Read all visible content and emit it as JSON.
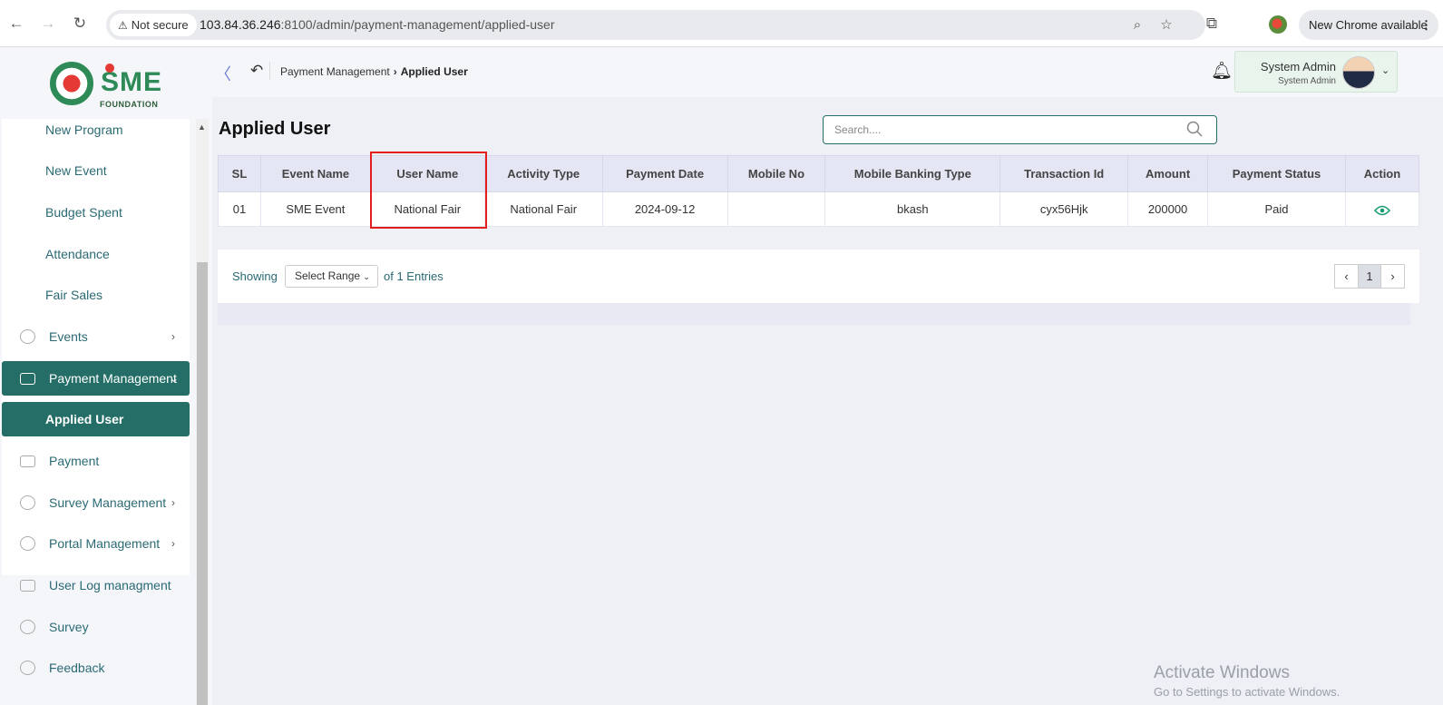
{
  "browser": {
    "security_label": "Not secure",
    "url_host": "103.84.36.246",
    "url_path": ":8100/admin/payment-management/applied-user",
    "update_label": "New Chrome available"
  },
  "logo": {
    "brand": "SME",
    "sub": "FOUNDATION"
  },
  "sidebar": {
    "items": [
      {
        "label": "New Program"
      },
      {
        "label": "New Event"
      },
      {
        "label": "Budget Spent"
      },
      {
        "label": "Attendance"
      },
      {
        "label": "Fair Sales"
      },
      {
        "label": "Events",
        "chevron": "›"
      },
      {
        "label": "Payment Management",
        "chevron": "⌄"
      },
      {
        "label": "Applied User"
      },
      {
        "label": "Payment"
      },
      {
        "label": "Survey Management",
        "chevron": "›"
      },
      {
        "label": "Portal Management",
        "chevron": "›"
      },
      {
        "label": "User Log managment"
      },
      {
        "label": "Survey"
      },
      {
        "label": "Feedback"
      }
    ]
  },
  "breadcrumb": {
    "parent": "Payment Management",
    "current": "Applied User"
  },
  "user": {
    "name": "System Admin",
    "role": "System Admin"
  },
  "page": {
    "title": "Applied User"
  },
  "search": {
    "placeholder": "Search...."
  },
  "table": {
    "headers": [
      "SL",
      "Event Name",
      "User Name",
      "Activity Type",
      "Payment Date",
      "Mobile No",
      "Mobile Banking Type",
      "Transaction Id",
      "Amount",
      "Payment Status",
      "Action"
    ],
    "rows": [
      [
        "01",
        "SME Event",
        "National Fair",
        "National Fair",
        "2024-09-12",
        "",
        "bkash",
        "cyx56Hjk",
        "200000",
        "Paid"
      ]
    ]
  },
  "pagination": {
    "showing": "Showing",
    "range_select": "Select Range",
    "entries": "of 1 Entries",
    "current_page": "1"
  },
  "watermark": {
    "line1": "Activate Windows",
    "line2": "Go to Settings to activate Windows."
  },
  "colors": {
    "accent": "#246e67",
    "highlight": "#e41e1e",
    "header_bg": "#e4e6f4"
  }
}
